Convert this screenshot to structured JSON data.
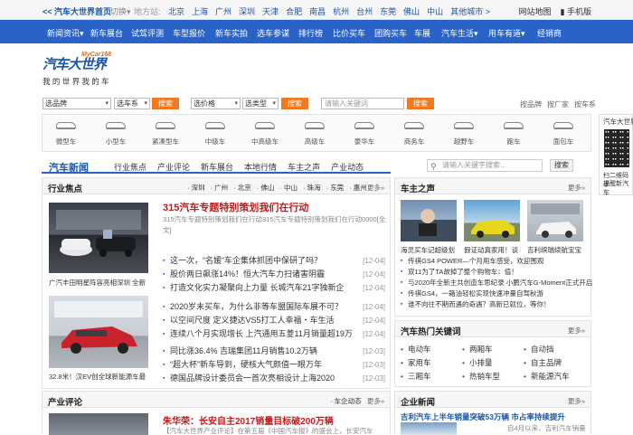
{
  "topbar": {
    "home": "<< 汽车大世界首页",
    "switch": "切换▾",
    "station_label": "地方站:",
    "cities": [
      "北京",
      "上海",
      "广州",
      "深圳",
      "天津",
      "合肥",
      "南昌",
      "杭州",
      "台州",
      "东莞",
      "佛山",
      "中山",
      "其他城市 >"
    ],
    "sitemap": "网站地图",
    "mobile": "手机版"
  },
  "nav": [
    "新闻资讯▾",
    "新车展台",
    "试驾评测",
    "车型报价",
    "新车实拍",
    "选车参谋",
    "排行榜",
    "比价买车",
    "团购买车",
    "车展",
    "汽车生活▾",
    "用车有道▾",
    "经销商"
  ],
  "logo": {
    "main": "汽车大世界",
    "sup": "MyCar168",
    "slogan": "我 的 世 界   我 的 车"
  },
  "search": {
    "brand": "选品牌",
    "series": "选车系",
    "price": "选价格",
    "type": "选类型",
    "btn": "搜索",
    "keyword_placeholder": "请输入关键词",
    "links": [
      "按品牌",
      "按厂家",
      "按车系"
    ]
  },
  "car_types": [
    "微型车",
    "小型车",
    "紧凑型车",
    "中级车",
    "中高级车",
    "高级车",
    "豪华车",
    "商务车",
    "越野车",
    "跑车",
    "面包车"
  ],
  "side_ad": {
    "title": "汽车大世界",
    "line1": "扫二维码手",
    "line2": "提醒新汽车"
  },
  "news_nav": {
    "title": "汽车新闻",
    "tabs": [
      "行业焦点",
      "产业评论",
      "新车展台",
      "本地行情",
      "车主之声",
      "产业动态"
    ],
    "search_placeholder": "请输入关键字搜索...",
    "search_btn": "搜索"
  },
  "industry": {
    "title": "行业焦点",
    "cities": [
      "· 深圳",
      "· 广州",
      "· 北京",
      "· 佛山",
      "· 中山",
      "· 珠海",
      "· 东莞",
      "· 惠州"
    ],
    "more": "更多»",
    "img1_caption": "广汽丰田明星阵容亮相深圳 全新",
    "img2_caption": "32.8米！汉EV创全球新能源车最",
    "headline": "315汽车专题特别策划我们在行动",
    "summary": "315汽车专题特别策划我们在行动315汽车专题特别策划我们在行动0000[全文]",
    "list1": [
      {
        "t": "这一次，“名媛”车企集体抓团中保研了吗？",
        "d": "[12-04]"
      },
      {
        "t": "股价两日飙涨14%！恒大汽车力扫诸害阴霾",
        "d": "[12-04]"
      },
      {
        "t": "打造文化实力凝聚向上力量 长城汽车21字独新企",
        "d": "[12-04]"
      }
    ],
    "list2": [
      {
        "t": "2020岁末买车，为什么非等车盟国际车展不可？",
        "d": "[12-04]"
      },
      {
        "t": "以空间尺度 定义捷达VS5打工人幸福・车生活",
        "d": "[12-04]"
      },
      {
        "t": "连续八个月实现增长 上汽通用五菱11月销量超19万",
        "d": "[12-04]"
      }
    ],
    "list3": [
      {
        "t": "同比涨36.4% 吉瑞集团11月销售10.2万辆",
        "d": "[12-03]"
      },
      {
        "t": "“超大杯”新车导到，硬核大气颜值一眼万年",
        "d": "[12-03]"
      },
      {
        "t": "德国品牌设计委员会一首次亮相设计上海2020",
        "d": "[12-03]"
      }
    ]
  },
  "owner_voice": {
    "title": "车主之声",
    "more": "更多»",
    "thumbs": [
      "海灵买车记超级划",
      "假证动真家用！谈",
      "吉利缤瑞续航宝宝"
    ],
    "list": [
      "传祺GS4 POWER—个月用车感受，欢迎围观",
      "双11为了TA故掉了整个购物车：值！",
      "与2020年全新主共创造车思纪录 小鹏汽车G-Moment正式开启",
      "传祺GS4，一箱油轻松实现快速冲量自驾秋游",
      "谁不向往不期而遇的奇遇？高新已就位，等你！"
    ]
  },
  "hot_tags": {
    "title": "汽车热门关键词",
    "more": "更多»",
    "tags": [
      "电动车",
      "两厢车",
      "自动挡",
      "家用车",
      "小排量",
      "自主品牌",
      "三厢车",
      "热销车型",
      "新能源汽车"
    ]
  },
  "industry_review": {
    "title": "产业评论",
    "sub": "· 车企动态",
    "more": "更多»",
    "headline": "朱华荣：长安自主2017销量目标破200万辆",
    "summary": "【汽车大世界产业评论】在第五届《中国汽车报》的盛会上，长安汽车"
  },
  "enterprise": {
    "title": "企业新闻",
    "more": "更多»",
    "headline": "吉利汽车上半年销量突破53万辆 市占率持续提升",
    "summary": "自4月以来，吉利汽车销量持续"
  }
}
